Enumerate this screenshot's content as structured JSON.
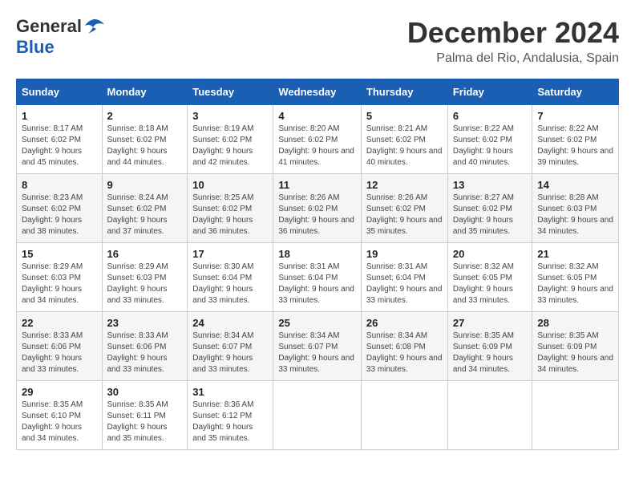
{
  "header": {
    "logo": {
      "general": "General",
      "blue": "Blue"
    },
    "title": "December 2024",
    "location": "Palma del Rio, Andalusia, Spain"
  },
  "calendar": {
    "days_of_week": [
      "Sunday",
      "Monday",
      "Tuesday",
      "Wednesday",
      "Thursday",
      "Friday",
      "Saturday"
    ],
    "weeks": [
      [
        {
          "day": "1",
          "sunrise": "8:17 AM",
          "sunset": "6:02 PM",
          "daylight": "9 hours and 45 minutes."
        },
        {
          "day": "2",
          "sunrise": "8:18 AM",
          "sunset": "6:02 PM",
          "daylight": "9 hours and 44 minutes."
        },
        {
          "day": "3",
          "sunrise": "8:19 AM",
          "sunset": "6:02 PM",
          "daylight": "9 hours and 42 minutes."
        },
        {
          "day": "4",
          "sunrise": "8:20 AM",
          "sunset": "6:02 PM",
          "daylight": "9 hours and 41 minutes."
        },
        {
          "day": "5",
          "sunrise": "8:21 AM",
          "sunset": "6:02 PM",
          "daylight": "9 hours and 40 minutes."
        },
        {
          "day": "6",
          "sunrise": "8:22 AM",
          "sunset": "6:02 PM",
          "daylight": "9 hours and 40 minutes."
        },
        {
          "day": "7",
          "sunrise": "8:22 AM",
          "sunset": "6:02 PM",
          "daylight": "9 hours and 39 minutes."
        }
      ],
      [
        {
          "day": "8",
          "sunrise": "8:23 AM",
          "sunset": "6:02 PM",
          "daylight": "9 hours and 38 minutes."
        },
        {
          "day": "9",
          "sunrise": "8:24 AM",
          "sunset": "6:02 PM",
          "daylight": "9 hours and 37 minutes."
        },
        {
          "day": "10",
          "sunrise": "8:25 AM",
          "sunset": "6:02 PM",
          "daylight": "9 hours and 36 minutes."
        },
        {
          "day": "11",
          "sunrise": "8:26 AM",
          "sunset": "6:02 PM",
          "daylight": "9 hours and 36 minutes."
        },
        {
          "day": "12",
          "sunrise": "8:26 AM",
          "sunset": "6:02 PM",
          "daylight": "9 hours and 35 minutes."
        },
        {
          "day": "13",
          "sunrise": "8:27 AM",
          "sunset": "6:02 PM",
          "daylight": "9 hours and 35 minutes."
        },
        {
          "day": "14",
          "sunrise": "8:28 AM",
          "sunset": "6:03 PM",
          "daylight": "9 hours and 34 minutes."
        }
      ],
      [
        {
          "day": "15",
          "sunrise": "8:29 AM",
          "sunset": "6:03 PM",
          "daylight": "9 hours and 34 minutes."
        },
        {
          "day": "16",
          "sunrise": "8:29 AM",
          "sunset": "6:03 PM",
          "daylight": "9 hours and 33 minutes."
        },
        {
          "day": "17",
          "sunrise": "8:30 AM",
          "sunset": "6:04 PM",
          "daylight": "9 hours and 33 minutes."
        },
        {
          "day": "18",
          "sunrise": "8:31 AM",
          "sunset": "6:04 PM",
          "daylight": "9 hours and 33 minutes."
        },
        {
          "day": "19",
          "sunrise": "8:31 AM",
          "sunset": "6:04 PM",
          "daylight": "9 hours and 33 minutes."
        },
        {
          "day": "20",
          "sunrise": "8:32 AM",
          "sunset": "6:05 PM",
          "daylight": "9 hours and 33 minutes."
        },
        {
          "day": "21",
          "sunrise": "8:32 AM",
          "sunset": "6:05 PM",
          "daylight": "9 hours and 33 minutes."
        }
      ],
      [
        {
          "day": "22",
          "sunrise": "8:33 AM",
          "sunset": "6:06 PM",
          "daylight": "9 hours and 33 minutes."
        },
        {
          "day": "23",
          "sunrise": "8:33 AM",
          "sunset": "6:06 PM",
          "daylight": "9 hours and 33 minutes."
        },
        {
          "day": "24",
          "sunrise": "8:34 AM",
          "sunset": "6:07 PM",
          "daylight": "9 hours and 33 minutes."
        },
        {
          "day": "25",
          "sunrise": "8:34 AM",
          "sunset": "6:07 PM",
          "daylight": "9 hours and 33 minutes."
        },
        {
          "day": "26",
          "sunrise": "8:34 AM",
          "sunset": "6:08 PM",
          "daylight": "9 hours and 33 minutes."
        },
        {
          "day": "27",
          "sunrise": "8:35 AM",
          "sunset": "6:09 PM",
          "daylight": "9 hours and 34 minutes."
        },
        {
          "day": "28",
          "sunrise": "8:35 AM",
          "sunset": "6:09 PM",
          "daylight": "9 hours and 34 minutes."
        }
      ],
      [
        {
          "day": "29",
          "sunrise": "8:35 AM",
          "sunset": "6:10 PM",
          "daylight": "9 hours and 34 minutes."
        },
        {
          "day": "30",
          "sunrise": "8:35 AM",
          "sunset": "6:11 PM",
          "daylight": "9 hours and 35 minutes."
        },
        {
          "day": "31",
          "sunrise": "8:36 AM",
          "sunset": "6:12 PM",
          "daylight": "9 hours and 35 minutes."
        },
        null,
        null,
        null,
        null
      ]
    ],
    "labels": {
      "sunrise": "Sunrise:",
      "sunset": "Sunset:",
      "daylight": "Daylight:"
    }
  }
}
